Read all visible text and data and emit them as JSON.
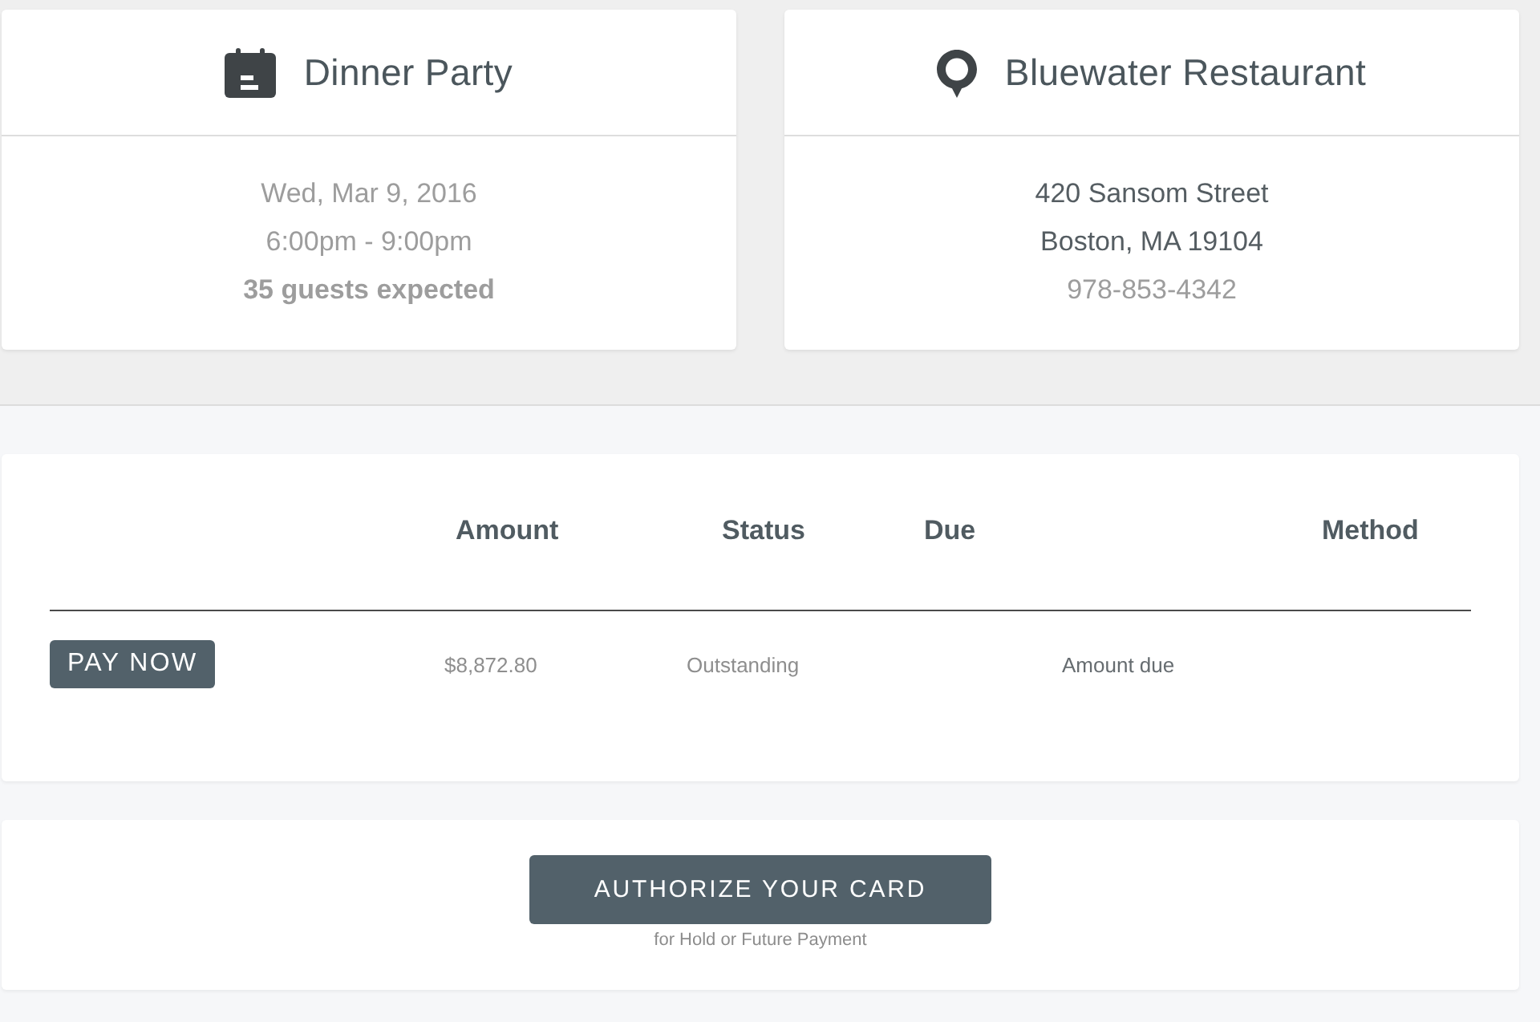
{
  "cards": [
    {
      "kind": "event",
      "title": "Dinner Party",
      "lines": [
        {
          "text": "Wed, Mar 9, 2016",
          "kind": "muted"
        },
        {
          "text": "6:00pm - 9:00pm",
          "kind": "muted"
        },
        {
          "text": "35 guests expected",
          "kind": "strong"
        }
      ]
    },
    {
      "kind": "venue",
      "title": "Bluewater Restaurant",
      "lines": [
        {
          "text": "420 Sansom Street",
          "kind": "dark"
        },
        {
          "text": "Boston, MA 19104",
          "kind": "dark"
        },
        {
          "text": "978-853-4342",
          "kind": "muted"
        }
      ]
    }
  ],
  "payments_table": {
    "columns": [
      "Amount",
      "Status",
      "Due",
      "Method"
    ],
    "rows": [
      {
        "action": "PAY NOW",
        "amount": "$8,872.80",
        "status": "Outstanding",
        "due": "Amount due"
      }
    ]
  },
  "authorize": {
    "button": "AUTHORIZE YOUR CARD",
    "caption": "for Hold or Future Payment"
  }
}
